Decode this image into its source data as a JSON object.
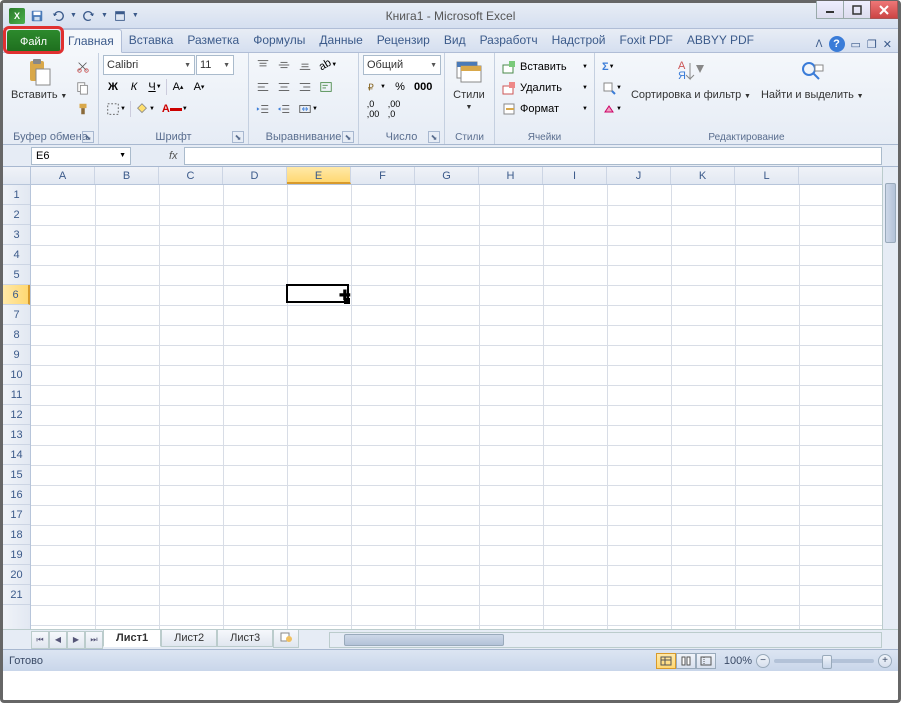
{
  "window": {
    "title": "Книга1 - Microsoft Excel"
  },
  "qat": {
    "save": "💾",
    "undo": "↶",
    "redo": "↷"
  },
  "tabs": {
    "file": "Файл",
    "items": [
      "Главная",
      "Вставка",
      "Разметка",
      "Формулы",
      "Данные",
      "Рецензир",
      "Вид",
      "Разработч",
      "Надстрой",
      "Foxit PDF",
      "ABBYY PDF"
    ],
    "active": 0
  },
  "ribbon": {
    "clipboard": {
      "paste": "Вставить",
      "label": "Буфер обмена"
    },
    "font": {
      "name": "Calibri",
      "size": "11",
      "bold": "Ж",
      "italic": "К",
      "underline": "Ч",
      "label": "Шрифт"
    },
    "alignment": {
      "label": "Выравнивание"
    },
    "number": {
      "format": "Общий",
      "label": "Число"
    },
    "styles": {
      "btn": "Стили",
      "label": "Стили"
    },
    "cells": {
      "insert": "Вставить",
      "delete": "Удалить",
      "format": "Формат",
      "label": "Ячейки"
    },
    "editing": {
      "sort": "Сортировка и фильтр",
      "find": "Найти и выделить",
      "label": "Редактирование"
    }
  },
  "namebox": "E6",
  "grid": {
    "columns": [
      "A",
      "B",
      "C",
      "D",
      "E",
      "F",
      "G",
      "H",
      "I",
      "J",
      "K",
      "L"
    ],
    "rows": [
      1,
      2,
      3,
      4,
      5,
      6,
      7,
      8,
      9,
      10,
      11,
      12,
      13,
      14,
      15,
      16,
      17,
      18,
      19,
      20,
      21
    ],
    "selected": {
      "col": "E",
      "row": 6
    }
  },
  "sheets": {
    "items": [
      "Лист1",
      "Лист2",
      "Лист3"
    ],
    "active": 0
  },
  "status": {
    "ready": "Готово",
    "zoom": "100%"
  }
}
